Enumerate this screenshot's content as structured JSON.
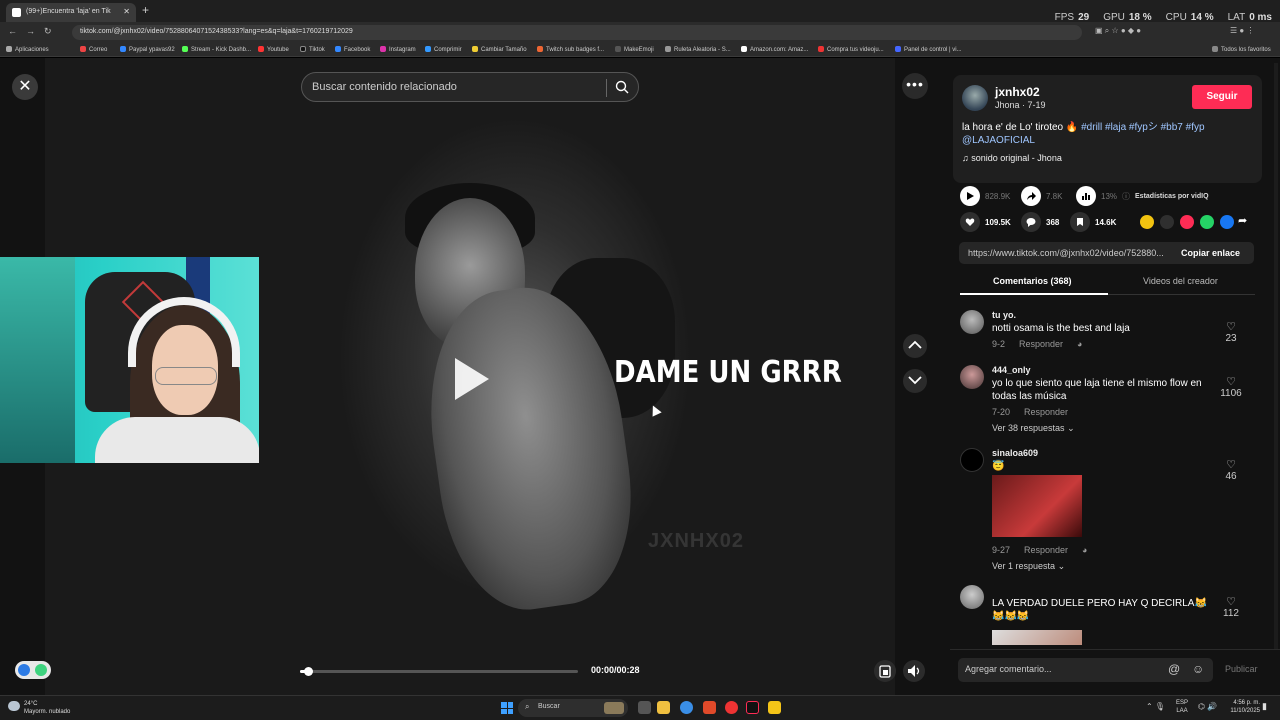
{
  "browser": {
    "tab_title": "(99+)Encuentra 'laja' en Tik",
    "url": "tiktok.com/@jxnhx02/video/7528806407152438533?lang=es&q=laja&t=1760219712029",
    "perf": {
      "fps_label": "FPS",
      "fps": "29",
      "gpu_label": "GPU",
      "gpu": "18 %",
      "cpu_label": "CPU",
      "cpu": "14 %",
      "lat_label": "LAT",
      "lat": "0 ms"
    },
    "bookmarks": [
      "Aplicaciones",
      "Correo",
      "Paypal ypavas92",
      "Stream - Kick Dashb...",
      "Youtube",
      "Tiktok",
      "Facebook",
      "Instagram",
      "Comprimir",
      "Cambiar Tamaño",
      "Twitch sub badges f...",
      "MakeEmoji",
      "Ruleta Aleatoria - S...",
      "Amazon.com: Amaz...",
      "Compra tus videoju...",
      "Panel de control | vi..."
    ],
    "bookmarks_all": "Todos los favoritos"
  },
  "video": {
    "search_placeholder": "Buscar contenido relacionado",
    "overlay_text": "DAME UN GRRR",
    "watermark": "JXNHX02",
    "time": "00:00/00:28",
    "progress": 0.03
  },
  "panel": {
    "author": {
      "handle": "jxnhx02",
      "sub": "Jhona · 7-19",
      "follow": "Seguir"
    },
    "caption_text": "la hora e' de Lo' tiroteo 🔥",
    "caption_tags": "#drill #laja #fypシ #bb7 #fyp",
    "caption_mention": "@LAJAOFICIAL",
    "sound": "sonido original - Jhona",
    "stats_top": {
      "plays": "828.9K",
      "shares": "7.8K",
      "percent": "13%",
      "vidiq": "Estadísticas por vidIQ"
    },
    "stats": {
      "likes": "109.5K",
      "comments": "368",
      "saves": "14.6K"
    },
    "link": "https://www.tiktok.com/@jxnhx02/video/752880...",
    "copy_link": "Copiar enlace",
    "tab_comments": "Comentarios (368)",
    "tab_creator": "Videos del creador",
    "reply_label": "Responder",
    "comments": [
      {
        "user": "tu yo.",
        "text": "notti osama is the best and laja",
        "date": "9-2",
        "likes": "23"
      },
      {
        "user": "444_only",
        "text": "yo lo que siento que laja tiene el mismo flow en todas las música",
        "date": "7-20",
        "likes": "1106",
        "more": "Ver 38 respuestas"
      },
      {
        "user": "sinaloa609",
        "text": "😇",
        "date": "9-27",
        "likes": "46",
        "more": "Ver 1 respuesta"
      },
      {
        "user": "",
        "text": "LA VERDAD DUELE PERO HAY Q DECIRLA😹😹😹😹",
        "likes": "112"
      }
    ],
    "comment_placeholder": "Agregar comentario...",
    "publish": "Publicar"
  },
  "taskbar": {
    "temp": "24°C",
    "weather": "Mayorm. nublado",
    "search": "Buscar",
    "lang1": "ESP",
    "lang2": "LAA",
    "time": "4:56 p. m.",
    "date": "11/10/2025"
  }
}
